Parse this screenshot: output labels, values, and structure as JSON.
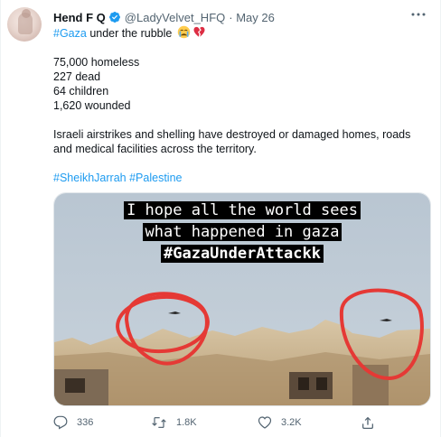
{
  "author": {
    "name": "Hend F Q",
    "handle": "@LadyVelvet_HFQ",
    "date": "· May 26",
    "verified": true
  },
  "tweet": {
    "hashtag_main": "#Gaza",
    "line1_rest": " under the rubble ",
    "emoji1": "crying-face",
    "emoji2": "broken-heart",
    "stats": [
      "75,000 homeless",
      "227 dead",
      "64 children",
      "1,620 wounded"
    ],
    "paragraph": "Israeli airstrikes and shelling have destroyed or damaged homes, roads and medical facilities across the territory.",
    "tag1": "#SheikhJarrah",
    "tag2": "#Palestine"
  },
  "media": {
    "caption_line1": "I hope all the world sees",
    "caption_line2": "what  happened in gaza",
    "caption_line3": "#GazaUnderAttackk"
  },
  "actions": {
    "reply_count": "336",
    "retweet_count": "1.8K",
    "like_count": "3.2K"
  },
  "icons": {
    "more": "more-horizontal-icon",
    "reply": "reply-icon",
    "retweet": "retweet-icon",
    "like": "heart-icon",
    "share": "share-icon"
  },
  "colors": {
    "link": "#1d9bf0",
    "secondary_text": "#536471",
    "verified": "#1d9bf0"
  }
}
